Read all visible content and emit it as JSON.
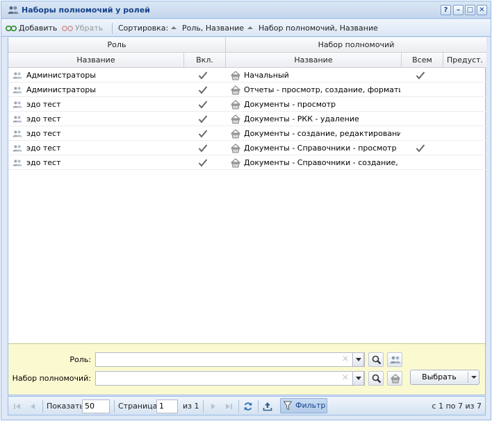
{
  "window": {
    "title": "Наборы полномочий у ролей",
    "tools": [
      "?",
      "–",
      "□",
      "✕"
    ]
  },
  "toolbar": {
    "add_label": "Добавить",
    "remove_label": "Убрать",
    "sort_label": "Сортировка:",
    "sort_role": "Роль, Название",
    "sort_set": "Набор полномочий, Название"
  },
  "grid": {
    "group_role": "Роль",
    "group_set": "Набор полномочий",
    "col_role_name": "Название",
    "col_enabled": "Вкл.",
    "col_set_name": "Название",
    "col_all": "Всем",
    "col_predefined": "Предуст.",
    "rows": [
      {
        "role": "Администраторы",
        "enabled": true,
        "set": "Начальный",
        "all": true
      },
      {
        "role": "Администраторы",
        "enabled": true,
        "set": "Отчеты - просмотр, создание, форматир...",
        "all": false
      },
      {
        "role": "эдо тест",
        "enabled": true,
        "set": "Документы - просмотр",
        "all": false
      },
      {
        "role": "эдо тест",
        "enabled": true,
        "set": "Документы - РКК - удаление",
        "all": false
      },
      {
        "role": "эдо тест",
        "enabled": true,
        "set": "Документы - создание, редактирование, ...",
        "all": false
      },
      {
        "role": "эдо тест",
        "enabled": true,
        "set": "Документы - Справочники - просмотр",
        "all": true
      },
      {
        "role": "эдо тест",
        "enabled": true,
        "set": "Документы - Справочники - создание, ре...",
        "all": false
      }
    ]
  },
  "filter": {
    "role_label": "Роль:",
    "role_value": "",
    "set_label": "Набор полномочий:",
    "set_value": "",
    "select_label": "Выбрать"
  },
  "paging": {
    "show_label": "Показать",
    "page_size": "50",
    "page_label": "Страница",
    "page_value": "1",
    "of_label": "из 1",
    "filter_label": "Фильтр",
    "summary": "с 1 по 7 из 7"
  },
  "colors": {
    "title_text": "#15428b",
    "border": "#99bbe8",
    "filter_bg": "#fbf9d0"
  }
}
